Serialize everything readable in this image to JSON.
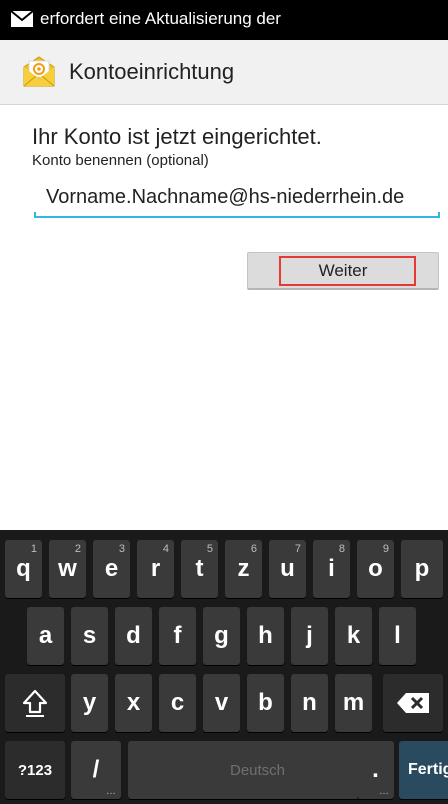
{
  "status_bar": {
    "notification_icon": "mail-icon",
    "text": "erfordert eine Aktualisierung der"
  },
  "action_bar": {
    "icon": "email-app-icon",
    "title": "Kontoeinrichtung"
  },
  "content": {
    "heading": "Ihr Konto ist jetzt eingerichtet.",
    "field_label": "Konto benennen (optional)",
    "field_value": "Vorname.Nachname@hs-niederrhein.de",
    "next_button_label": "Weiter",
    "highlight_color": "#e53935",
    "accent_color": "#33b5e5"
  },
  "keyboard": {
    "row1": [
      {
        "label": "q",
        "hint": "1"
      },
      {
        "label": "w",
        "hint": "2"
      },
      {
        "label": "e",
        "hint": "3"
      },
      {
        "label": "r",
        "hint": "4"
      },
      {
        "label": "t",
        "hint": "5"
      },
      {
        "label": "z",
        "hint": "6"
      },
      {
        "label": "u",
        "hint": "7"
      },
      {
        "label": "i",
        "hint": "8"
      },
      {
        "label": "o",
        "hint": "9"
      },
      {
        "label": "p",
        "hint": ""
      }
    ],
    "row2": [
      "a",
      "s",
      "d",
      "f",
      "g",
      "h",
      "j",
      "k",
      "l"
    ],
    "row3": [
      "y",
      "x",
      "c",
      "v",
      "b",
      "n",
      "m"
    ],
    "shift_icon": "shift-icon",
    "backspace_icon": "backspace-icon",
    "symbols_label": "?123",
    "slash_label": "/",
    "space_label": "Deutsch",
    "period_label": ".",
    "done_label": "Fertig"
  }
}
